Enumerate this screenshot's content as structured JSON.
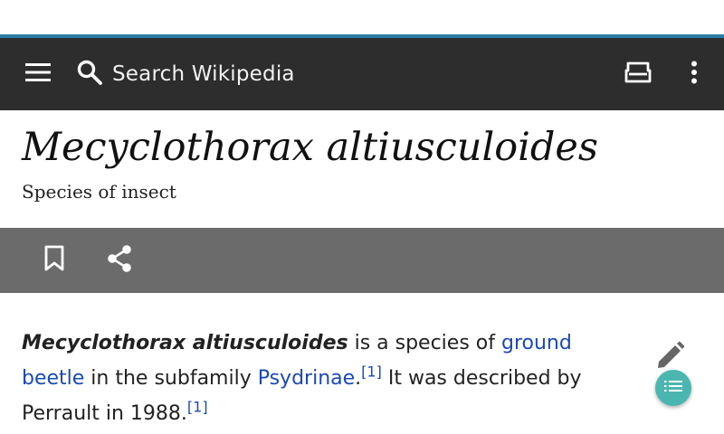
{
  "toolbar": {
    "search_placeholder": "Search Wikipedia",
    "icons": [
      "menu-icon",
      "search-icon",
      "reading-lists-icon",
      "overflow-icon"
    ],
    "background": "#2d2d2d",
    "accent": "#2a7fa6"
  },
  "article": {
    "title": "Mecyclothorax altiusculoides",
    "description": "Species of insect"
  },
  "actions": {
    "icons": [
      "bookmark-icon",
      "share-icon"
    ],
    "background": "#6b6b6b"
  },
  "body": {
    "bold_title": "Mecyclothorax altiusculoides",
    "text_1": " is a species of ",
    "link_1": "ground beetle",
    "text_2": " in the subfamily ",
    "link_2": "Psydrinae",
    "text_3": ".",
    "ref_1": "[1]",
    "text_4": " It was described by Perrault in 1988.",
    "ref_2": "[1]",
    "link_color": "#1a49b5"
  },
  "floating": {
    "edit_icon": "pencil-icon",
    "toc_icon": "toc-list-icon",
    "toc_color": "#4bb6b0"
  }
}
